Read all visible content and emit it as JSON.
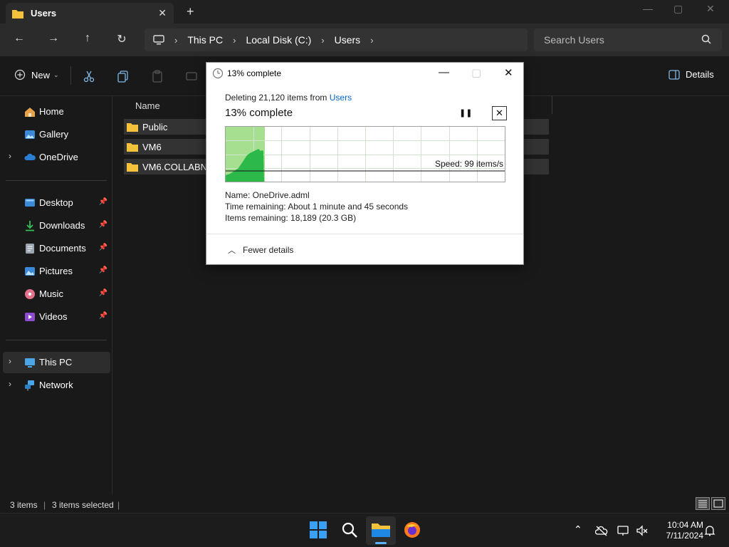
{
  "tab": {
    "label": "Users",
    "close": "✕",
    "add": "+"
  },
  "window_controls": {
    "minimize": "—",
    "maximize": "▢",
    "close": "✕"
  },
  "breadcrumb": [
    "This PC",
    "Local Disk (C:)",
    "Users"
  ],
  "search": {
    "placeholder": "Search Users"
  },
  "toolbar": {
    "new_label": "New",
    "details_label": "Details"
  },
  "sidebar": {
    "home": "Home",
    "gallery": "Gallery",
    "onedrive": "OneDrive",
    "desktop": "Desktop",
    "downloads": "Downloads",
    "documents": "Documents",
    "pictures": "Pictures",
    "music": "Music",
    "videos": "Videos",
    "thispc": "This PC",
    "network": "Network"
  },
  "content": {
    "column_name": "Name",
    "files": [
      "Public",
      "VM6",
      "VM6.COLLABNET"
    ]
  },
  "status": {
    "count": "3 items",
    "selected": "3 items selected"
  },
  "dialog": {
    "title": "13% complete",
    "line1_prefix": "Deleting 21,120 items from ",
    "line1_link": "Users",
    "percent_label": "13% complete",
    "progress_fraction": 0.13,
    "speed": "Speed: 99 items/s",
    "name_line": "Name:  OneDrive.adml",
    "time_line": "Time remaining:  About 1 minute and 45 seconds",
    "items_line": "Items remaining:  18,189 (20.3 GB)",
    "fewer_details": "Fewer details"
  },
  "clock": {
    "time": "10:04 AM",
    "date": "7/11/2024"
  },
  "colors": {
    "accent": "#0066cc",
    "graph_fill": "#2db84a",
    "graph_bg": "#a6df8f",
    "folder": "#f3c13a"
  }
}
